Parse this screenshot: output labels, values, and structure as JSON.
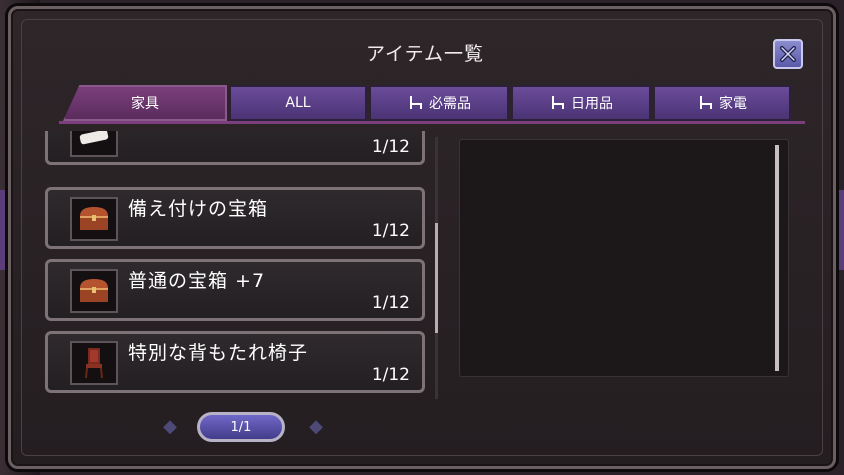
{
  "window": {
    "title": "アイテム一覧"
  },
  "tabs": [
    {
      "label": "家具",
      "active": true,
      "icon": null
    },
    {
      "label": "ALL",
      "active": false,
      "icon": null
    },
    {
      "label": "必需品",
      "active": false,
      "icon": "chair-icon"
    },
    {
      "label": "日用品",
      "active": false,
      "icon": "chair-icon"
    },
    {
      "label": "家電",
      "active": false,
      "icon": "chair-icon"
    }
  ],
  "items": [
    {
      "name": "備え付けの宝箱",
      "count": "1/12",
      "icon": "treasure-chest-icon"
    },
    {
      "name": "普通の宝箱 +7",
      "count": "1/12",
      "icon": "treasure-chest-icon"
    },
    {
      "name": "特別な背もたれ椅子",
      "count": "1/12",
      "icon": "chair-icon"
    }
  ],
  "partial_item": {
    "count": "1/12",
    "icon": "pillow-icon"
  },
  "pager": {
    "label": "1/1"
  },
  "colors": {
    "accent": "#7a3f7c",
    "tab": "#6b4c9a",
    "close": "#5a5aa8"
  }
}
